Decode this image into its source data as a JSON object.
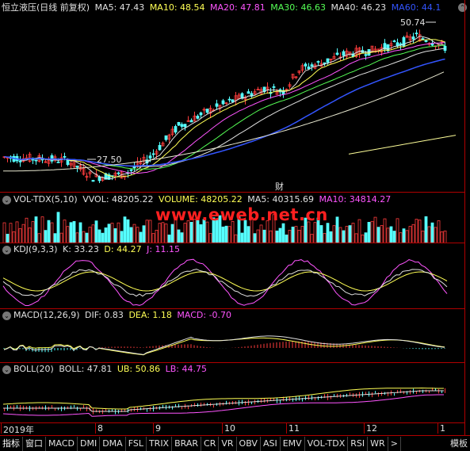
{
  "price": {
    "title": "恒立液压(日线 前复权)",
    "ma": [
      {
        "label": "MA5: 47.43",
        "color": "#e0e0e0"
      },
      {
        "label": "MA10: 48.54",
        "color": "#ffff55"
      },
      {
        "label": "MA20: 47.81",
        "color": "#ff55ff"
      },
      {
        "label": "MA30: 46.63",
        "color": "#55ff55"
      },
      {
        "label": "MA40: 46.23",
        "color": "#e0e0e0"
      },
      {
        "label": "MA60: 44.1",
        "color": "#3355ff"
      }
    ],
    "high_label": "50.74",
    "low_label": "27.50",
    "cai_label": "财"
  },
  "vol": {
    "title": "VOL-TDX(5,10)",
    "items": [
      {
        "label": "VVOL: 48205.22",
        "color": "#e0e0e0"
      },
      {
        "label": "VOLUME: 48205.22",
        "color": "#ffff55"
      },
      {
        "label": "MA5: 40315.69",
        "color": "#e0e0e0"
      },
      {
        "label": "MA10: 34814.27",
        "color": "#ff55ff"
      }
    ]
  },
  "kdj": {
    "title": "KDJ(9,3,3)",
    "items": [
      {
        "label": "K: 33.23",
        "color": "#e0e0e0"
      },
      {
        "label": "D: 44.27",
        "color": "#ffff55"
      },
      {
        "label": "J: 11.15",
        "color": "#ff55ff"
      }
    ]
  },
  "macd": {
    "title": "MACD(12,26,9)",
    "items": [
      {
        "label": "DIF: 0.83",
        "color": "#e0e0e0"
      },
      {
        "label": "DEA: 1.18",
        "color": "#ffff55"
      },
      {
        "label": "MACD: -0.70",
        "color": "#ff55ff"
      }
    ]
  },
  "boll": {
    "title": "BOLL(20)",
    "items": [
      {
        "label": "BOLL: 47.81",
        "color": "#e0e0e0"
      },
      {
        "label": "UB: 50.86",
        "color": "#ffff55"
      },
      {
        "label": "LB: 44.75",
        "color": "#ff55ff"
      }
    ]
  },
  "xaxis": [
    "2019年",
    "8",
    "9",
    "10",
    "11",
    "12",
    "1"
  ],
  "watermark": "www.eweb.net.cn",
  "tabs": [
    "指标",
    "窗口",
    "MACD",
    "DMI",
    "DMA",
    "FSL",
    "TRIX",
    "BRAR",
    "CR",
    "VR",
    "OBV",
    "ASI",
    "EMV",
    "VOL-TDX",
    "RSI",
    "WR",
    ">",
    "模板"
  ],
  "colors": {
    "up": "#ff3c3c",
    "down": "#55ffff",
    "grid": "#b00000"
  }
}
